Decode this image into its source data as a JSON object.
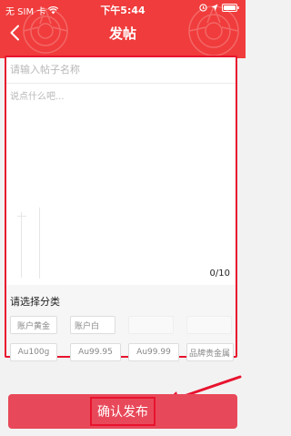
{
  "status_bar": {
    "carrier": "无 SIM 卡",
    "time": "下午5:44"
  },
  "header": {
    "title": "发帖"
  },
  "form": {
    "title_placeholder": "请输入帖子名称",
    "content_placeholder": "说点什么吧...",
    "char_count": "0/10"
  },
  "category": {
    "label": "请选择分类",
    "tags": [
      "账户黄金",
      "账户白",
      "Au100g",
      "Au99.95",
      "Au99.99",
      "品牌贵金属"
    ]
  },
  "submit": {
    "label": "确认发布"
  },
  "colors": {
    "header_bg": "#f03c3c",
    "submit_bg": "#e8495a",
    "highlight_border": "#e8132e"
  },
  "icons": [
    "back-arrow-icon",
    "wifi-icon",
    "battery-icon",
    "location-icon",
    "alarm-icon",
    "pointer-arrow-icon"
  ]
}
